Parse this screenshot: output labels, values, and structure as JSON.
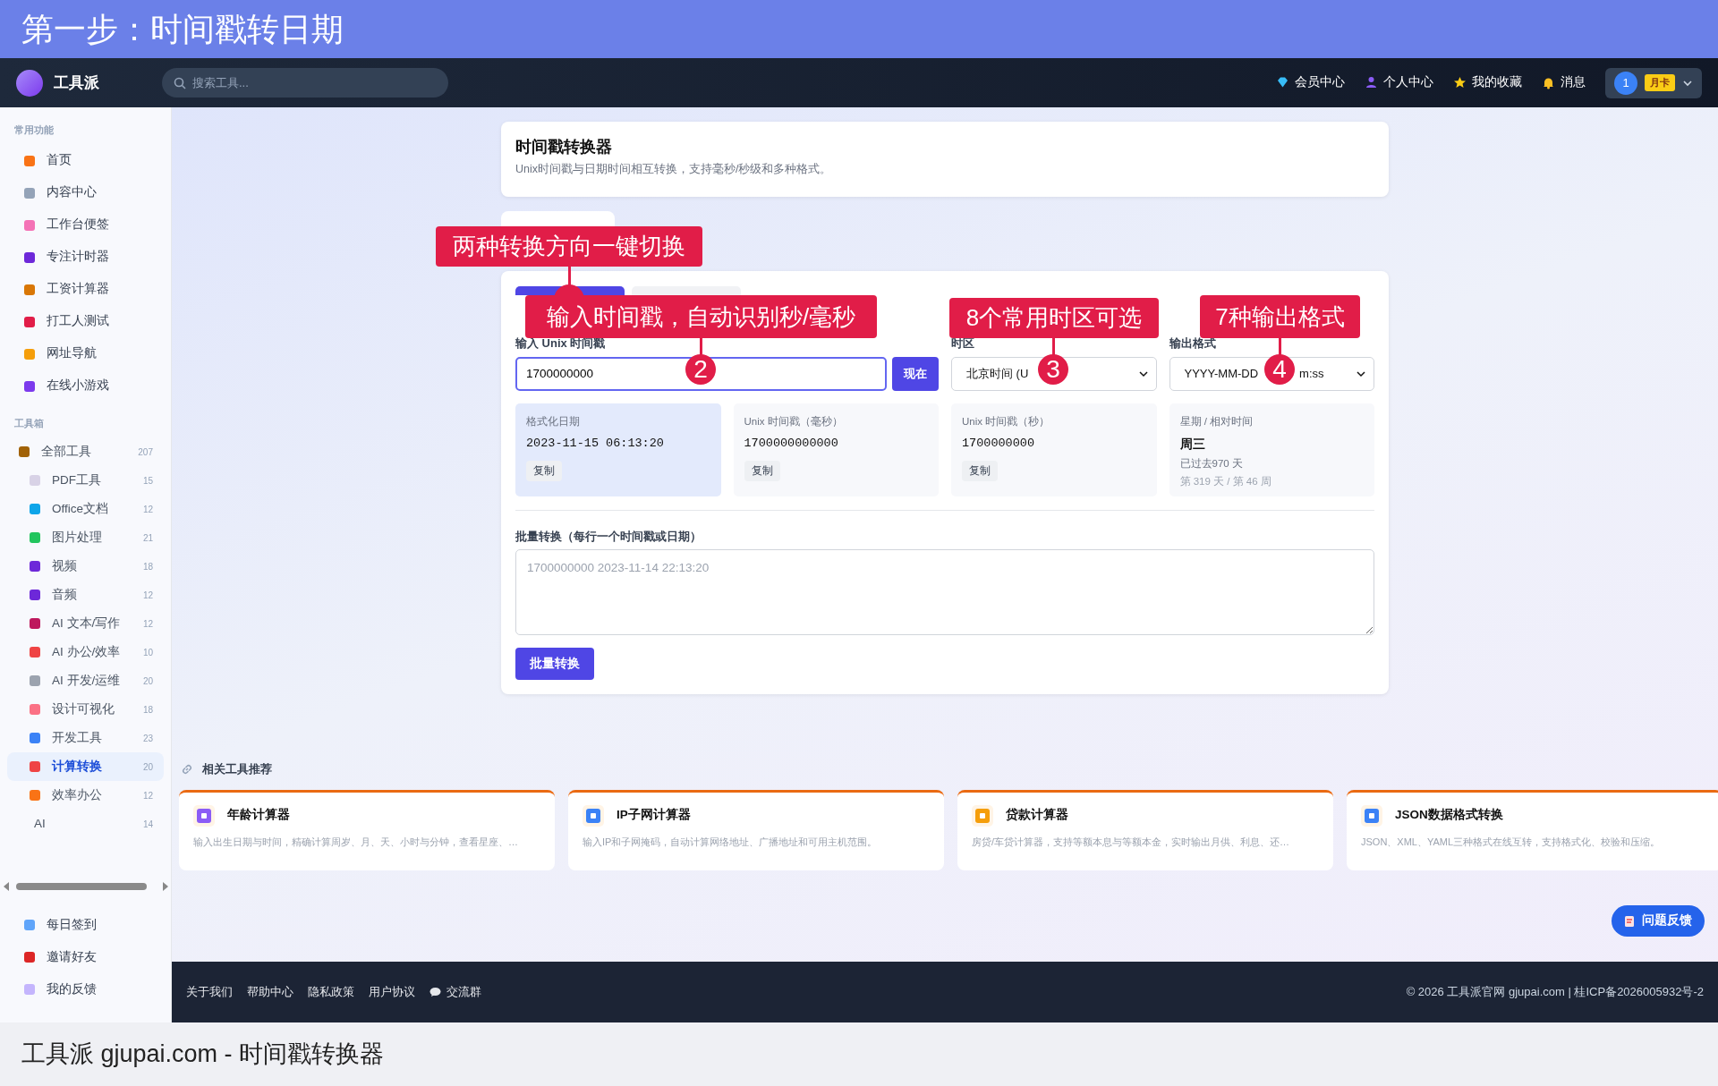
{
  "banner_top": {
    "title": "第一步：时间戳转日期"
  },
  "navbar": {
    "brand": "工具派",
    "search": {
      "placeholder": "搜索工具..."
    },
    "links": [
      {
        "label": "会员中心",
        "kind": "diamond"
      },
      {
        "label": "个人中心",
        "kind": "person"
      },
      {
        "label": "我的收藏",
        "kind": "star"
      },
      {
        "label": "消息",
        "kind": "bell"
      }
    ],
    "user": {
      "avatar": "1",
      "badge": "月卡"
    }
  },
  "sidebar": {
    "sections": [
      {
        "heading": "常用功能",
        "items": [
          {
            "label": "首页",
            "kind": "icon",
            "selected": false
          },
          {
            "label": "内容中心",
            "kind": "icon",
            "selected": false
          },
          {
            "label": "工作台便签",
            "kind": "icon",
            "selected": false
          },
          {
            "label": "专注计时器",
            "kind": "icon",
            "selected": false
          },
          {
            "label": "工资计算器",
            "kind": "icon",
            "selected": false
          },
          {
            "label": "打工人测试",
            "kind": "icon",
            "selected": false
          },
          {
            "label": "网址导航",
            "kind": "icon",
            "selected": false
          },
          {
            "label": "在线小游戏",
            "kind": "icon",
            "selected": false
          }
        ]
      },
      {
        "heading": "工具箱",
        "items": [
          {
            "label": "全部工具",
            "count": "207",
            "kind": "icon",
            "selected": false,
            "children": [
              {
                "label": "PDF工具",
                "count": "15",
                "kind": "icon",
                "selected": false
              },
              {
                "label": "Office文档",
                "count": "12",
                "kind": "icon",
                "selected": false
              },
              {
                "label": "图片处理",
                "count": "21",
                "kind": "icon",
                "selected": false
              },
              {
                "label": "视频",
                "count": "18",
                "kind": "icon",
                "selected": false
              },
              {
                "label": "音频",
                "count": "12",
                "kind": "icon",
                "selected": false
              },
              {
                "label": "AI 文本/写作",
                "count": "12",
                "kind": "icon",
                "selected": false
              },
              {
                "label": "AI 办公/效率",
                "count": "10",
                "kind": "icon",
                "selected": false
              },
              {
                "label": "AI 开发/运维",
                "count": "20",
                "kind": "icon",
                "selected": false
              },
              {
                "label": "设计可视化",
                "count": "18",
                "kind": "icon",
                "selected": false
              },
              {
                "label": "开发工具",
                "count": "23",
                "kind": "icon",
                "selected": false
              },
              {
                "label": "计算转换",
                "count": "20",
                "kind": "icon",
                "selected": true
              },
              {
                "label": "效率办公",
                "count": "12",
                "kind": "icon",
                "selected": false
              },
              {
                "label": "AI",
                "count": "14",
                "kind": "plain",
                "selected": false
              }
            ]
          }
        ]
      }
    ],
    "bottom_items": [
      {
        "label": "每日签到",
        "selected": false
      },
      {
        "label": "邀请好友",
        "selected": false
      },
      {
        "label": "我的反馈",
        "selected": false
      }
    ]
  },
  "header": {
    "title": "时间戳转换器",
    "subtitle": "Unix时间戳与日期时间相互转换，支持毫秒/秒级和多种格式。"
  },
  "converter": {
    "tabs": [
      {
        "selected": true
      },
      {
        "selected": false
      }
    ],
    "input": {
      "label": "输入 Unix 时间戳",
      "value": "1700000000",
      "button": "现在"
    },
    "timezone": {
      "label": "时区",
      "value": "北京时间 (U"
    },
    "format": {
      "label": "输出格式",
      "value_parts": [
        "YYYY-MM-DD",
        "m:ss"
      ]
    },
    "results": [
      {
        "kind": "copy",
        "label": "格式化日期",
        "value": "2023-11-15 06:13:20",
        "button": "复制",
        "highlighted": true
      },
      {
        "kind": "copy",
        "label": "Unix 时间戳（毫秒）",
        "value": "1700000000000",
        "button": "复制",
        "highlighted": false
      },
      {
        "kind": "copy",
        "label": "Unix 时间戳（秒）",
        "value": "1700000000",
        "button": "复制",
        "highlighted": false
      },
      {
        "kind": "info",
        "label": "星期 / 相对时间",
        "value": "周三",
        "lines": [
          "已过去970 天",
          "第 319 天 / 第 46 周"
        ],
        "highlighted": false
      }
    ],
    "batch": {
      "label": "批量转换（每行一个时间戳或日期）",
      "placeholder": "1700000000 2023-11-14 22:13:20",
      "button": "批量转换"
    }
  },
  "annotations": [
    {
      "text": "两种转换方向一键切换"
    },
    {
      "text": "输入时间戳，自动识别秒/毫秒",
      "number": "2"
    },
    {
      "text": "8个常用时区可选",
      "number": "3"
    },
    {
      "text": "7种输出格式",
      "number": "4"
    }
  ],
  "related": {
    "heading": "相关工具推荐",
    "cards": [
      {
        "title": "年龄计算器",
        "description": "输入出生日期与时间，精确计算周岁、月、天、小时与分钟，查看星座、…",
        "color": "#8b5cf6"
      },
      {
        "title": "IP子网计算器",
        "description": "输入IP和子网掩码，自动计算网络地址、广播地址和可用主机范围。",
        "color": "#3b82f6"
      },
      {
        "title": "贷款计算器",
        "description": "房贷/车贷计算器，支持等额本息与等额本金，实时输出月供、利息、还…",
        "color": "#f59e0b"
      },
      {
        "title": "JSON数据格式转换",
        "description": "JSON、XML、YAML三种格式在线互转，支持格式化、校验和压缩。",
        "color": "#3b82f6"
      }
    ]
  },
  "feedback_button": "问题反馈",
  "footer": {
    "links": [
      {
        "label": "关于我们",
        "kind": "text"
      },
      {
        "label": "帮助中心",
        "kind": "text"
      },
      {
        "label": "隐私政策",
        "kind": "text"
      },
      {
        "label": "用户协议",
        "kind": "text"
      },
      {
        "label": "交流群",
        "kind": "chat"
      }
    ],
    "copyright": "© 2026 工具派官网 gjupai.com | 桂ICP备2026005932号-2"
  },
  "banner_bottom": {
    "title": "工具派 gjupai.com - 时间戳转换器"
  }
}
